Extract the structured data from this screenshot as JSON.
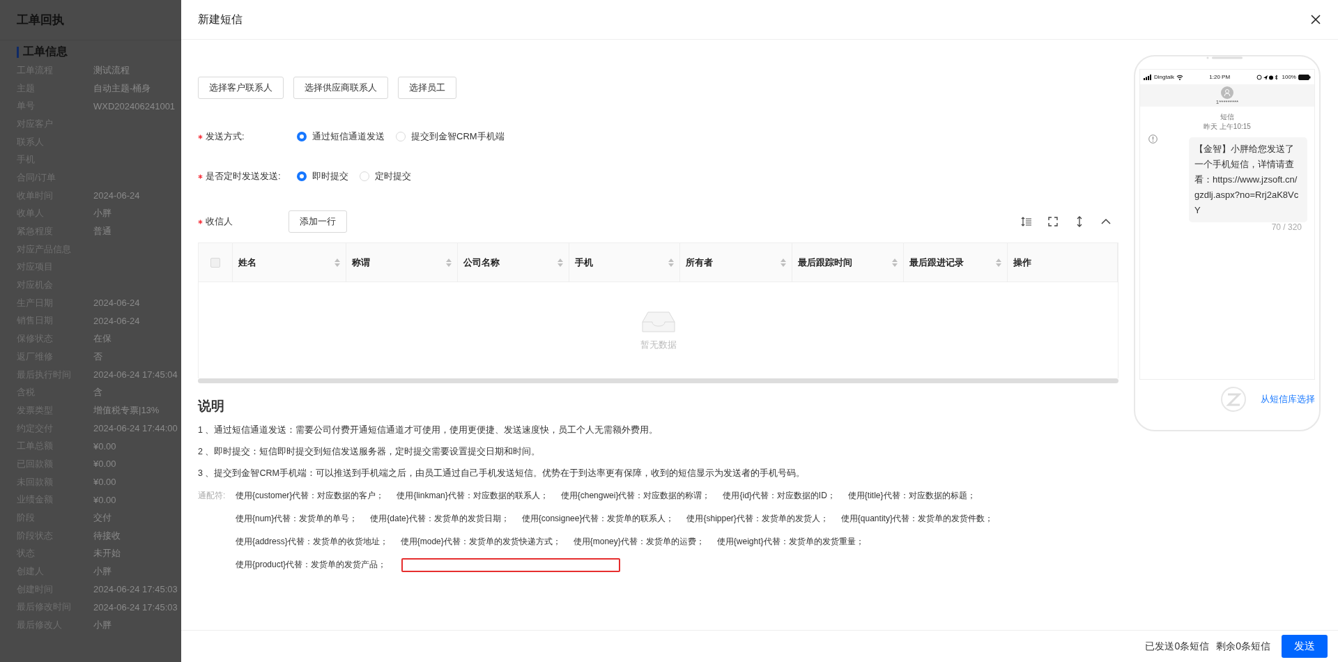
{
  "background_page": {
    "title": "工单回执",
    "section": "工单信息",
    "fields": [
      {
        "label": "工单流程",
        "value": "测试流程"
      },
      {
        "label": "主题",
        "value": "自动主题-桶身"
      },
      {
        "label": "单号",
        "value": "WXD202406241001"
      },
      {
        "label": "对应客户"
      },
      {
        "label": "联系人"
      },
      {
        "label": "手机"
      },
      {
        "label": "合同/订单"
      },
      {
        "label": "收单时间",
        "value": "2024-06-24"
      },
      {
        "label": "收单人",
        "value": "小胖"
      },
      {
        "label": "紧急程度",
        "value": "普通"
      },
      {
        "label": "对应产品信息"
      },
      {
        "label": "对应项目"
      },
      {
        "label": "对应机会"
      },
      {
        "label": "生产日期",
        "value": "2024-06-24"
      },
      {
        "label": "销售日期",
        "value": "2024-06-24"
      },
      {
        "label": "保修状态",
        "value": "在保"
      },
      {
        "label": "返厂维修",
        "value": "否"
      },
      {
        "label": "最后执行时间",
        "value": "2024-06-24 17:45:04"
      },
      {
        "label": "含税",
        "value": "含"
      },
      {
        "label": "发票类型",
        "value": "增值税专票|13%"
      },
      {
        "label": "约定交付",
        "value": "2024-06-24 17:44:00"
      },
      {
        "label": "工单总额",
        "value": "¥0.00"
      },
      {
        "label": "已回款额",
        "value": "¥0.00"
      },
      {
        "label": "未回款额",
        "value": "¥0.00"
      },
      {
        "label": "业绩金额",
        "value": "¥0.00"
      },
      {
        "label": "阶段",
        "value": "交付"
      },
      {
        "label": "阶段状态",
        "value": "待接收"
      },
      {
        "label": "状态",
        "value": "未开始"
      },
      {
        "label": "创建人",
        "value": "小胖"
      },
      {
        "label": "创建时间",
        "value": "2024-06-24 17:45:03"
      },
      {
        "label": "最后修改时间",
        "value": "2024-06-24 17:45:03"
      },
      {
        "label": "最后修改人",
        "value": "小胖"
      }
    ]
  },
  "drawer": {
    "title": "新建短信"
  },
  "contact_buttons": [
    "选择客户联系人",
    "选择供应商联系人",
    "选择员工"
  ],
  "send_method": {
    "label": "发送方式:",
    "required": true,
    "options": [
      {
        "label": "通过短信通道发送",
        "selected": true
      },
      {
        "label": "提交到金智CRM手机端",
        "selected": false
      }
    ]
  },
  "timing": {
    "label": "是否定时发送发送:",
    "required": true,
    "options": [
      {
        "label": "即时提交",
        "selected": true
      },
      {
        "label": "定时提交",
        "selected": false
      }
    ]
  },
  "recipients": {
    "label": "收信人",
    "required": true,
    "add_button": "添加一行",
    "select_all_checked": false,
    "empty_text": "暂无数据",
    "columns": [
      {
        "label": "姓名",
        "sortable": true
      },
      {
        "label": "称谓",
        "sortable": true
      },
      {
        "label": "公司名称",
        "sortable": true
      },
      {
        "label": "手机",
        "sortable": true
      },
      {
        "label": "所有者",
        "sortable": true
      },
      {
        "label": "最后跟踪时间",
        "sortable": true
      },
      {
        "label": "最后跟进记录",
        "sortable": true
      },
      {
        "label": "操作",
        "sortable": false
      }
    ]
  },
  "explanation": {
    "title": "说明",
    "items": [
      "1 、通过短信通道发送：需要公司付费开通短信通道才可使用，使用更便捷、发送速度快，员工个人无需额外费用。",
      "2 、即时提交：短信即时提交到短信发送服务器，定时提交需要设置提交日期和时间。",
      "3 、提交到金智CRM手机端：可以推送到手机端之后，由员工通过自己手机发送短信。优势在于到达率更有保障，收到的短信显示为发送者的手机号码。"
    ],
    "wildcard_label": "通配符:",
    "wildcard_lines": [
      [
        "使用{customer}代替：对应数据的客户；",
        "使用{linkman}代替：对应数据的联系人；",
        "使用{chengwei}代替：对应数据的称谓；",
        "使用{id}代替：对应数据的ID；",
        "使用{title}代替：对应数据的标题；"
      ],
      [
        "使用{num}代替：发货单的单号；",
        "使用{date}代替：发货单的发货日期；",
        "使用{consignee}代替：发货单的联系人；",
        "使用{shipper}代替：发货单的发货人；",
        "使用{quantity}代替：发货单的发货件数；"
      ],
      [
        "使用{address}代替：发货单的收货地址；",
        "使用{mode}代替：发货单的发货快递方式；",
        "使用{money}代替：发货单的运费；",
        "使用{weight}代替：发货单的发货重量；"
      ],
      [
        "使用{product}代替：发货单的发货产品；"
      ]
    ]
  },
  "phone": {
    "carrier": "Dingtalk",
    "time": "1:20 PM",
    "battery": "100%",
    "contact": "1*********",
    "thread_label": "短信",
    "thread_time": "昨天 上午10:15",
    "message": "【金智】小胖给您发送了一个手机短信，详情请查看：https://www.jzsoft.cn/gzdlj.aspx?no=Rrj2aK8VcY",
    "counter": "70 / 320",
    "library_link": "从短信库选择"
  },
  "footer": {
    "sent": "已发送0条短信",
    "remaining": "剩余0条短信",
    "send_button": "发送"
  }
}
